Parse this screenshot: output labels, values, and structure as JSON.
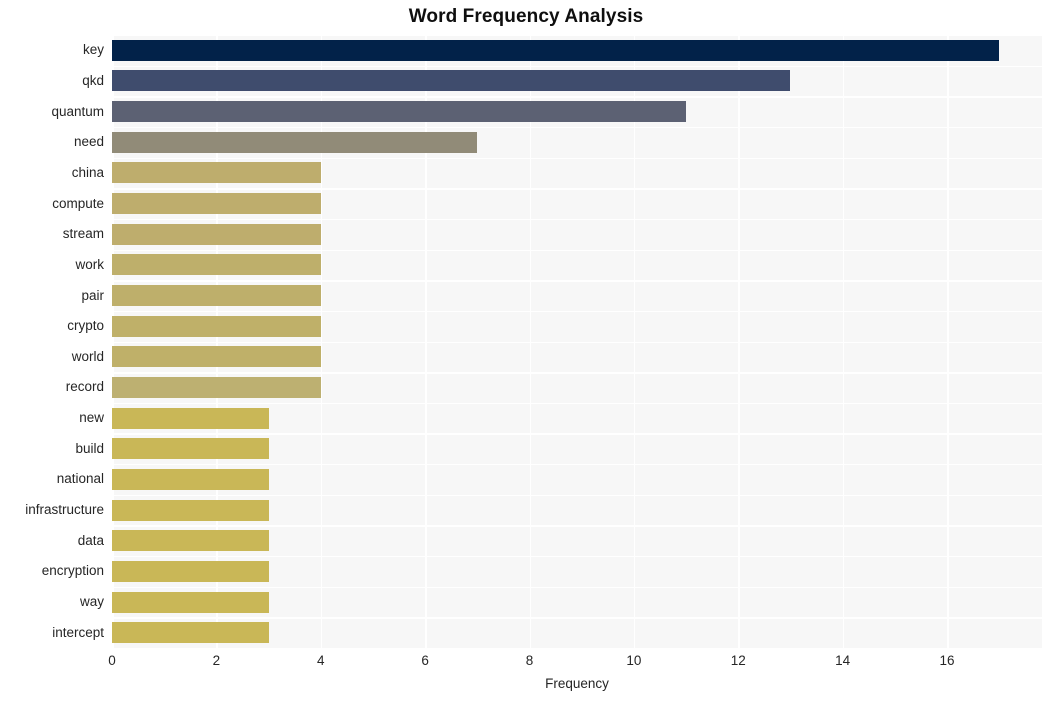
{
  "chart_data": {
    "type": "bar",
    "orientation": "horizontal",
    "title": "Word Frequency Analysis",
    "xlabel": "Frequency",
    "ylabel": "",
    "categories": [
      "key",
      "qkd",
      "quantum",
      "need",
      "china",
      "compute",
      "stream",
      "work",
      "pair",
      "crypto",
      "world",
      "record",
      "new",
      "build",
      "national",
      "infrastructure",
      "data",
      "encryption",
      "way",
      "intercept"
    ],
    "values": [
      17,
      13,
      11,
      7,
      4,
      4,
      4,
      4,
      4,
      4,
      4,
      4,
      3,
      3,
      3,
      3,
      3,
      3,
      3,
      3
    ],
    "xlim": [
      0,
      17.82
    ],
    "ylim": [
      19.5,
      -0.5
    ],
    "xticks": [
      0,
      2,
      4,
      6,
      8,
      10,
      12,
      14,
      16
    ],
    "xtick_labels": [
      "0",
      "2",
      "4",
      "6",
      "8",
      "10",
      "12",
      "14",
      "16"
    ],
    "grid": {
      "vertical": true,
      "horizontal": true,
      "color": "#ffffff"
    },
    "legend": null,
    "bar_colors": [
      "#022249",
      "#3f4c6d",
      "#5c6173",
      "#918b78",
      "#bead6d",
      "#bead6d",
      "#bead6d",
      "#beaf6b",
      "#beaf6b",
      "#bfb069",
      "#bfb069",
      "#bdb071",
      "#c9b757",
      "#c9b757",
      "#c9b757",
      "#c9b757",
      "#c9b757",
      "#c9b757",
      "#c9b757",
      "#c9b757"
    ],
    "plot_background": "#f7f7f7",
    "figure_background": "#ffffff",
    "text_color": "#262626"
  }
}
